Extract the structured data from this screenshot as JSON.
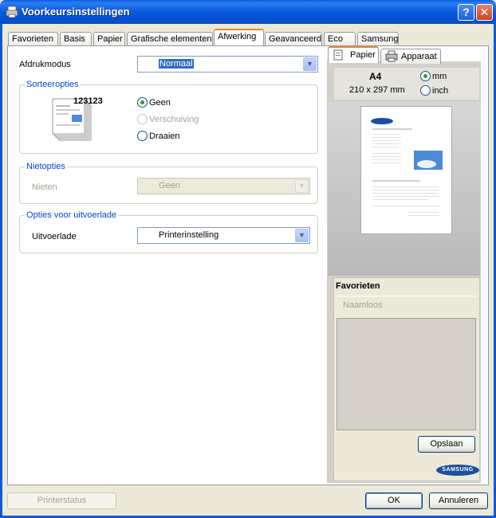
{
  "window": {
    "title": "Voorkeursinstellingen"
  },
  "tabs": [
    "Favorieten",
    "Basis",
    "Papier",
    "Grafische elementen",
    "Afwerking",
    "Geavanceerd",
    "Eco",
    "Samsung"
  ],
  "active_tab": "Afwerking",
  "print_mode": {
    "label": "Afdrukmodus",
    "value": "Normaal"
  },
  "collate": {
    "legend": "Sorteeropties",
    "preview_number": "123123",
    "options": [
      "Geen",
      "Verschuiving",
      "Draaien"
    ],
    "selected": "Geen"
  },
  "staple": {
    "legend": "Nietopties",
    "label": "Nieten",
    "value": "Geen"
  },
  "output_tray": {
    "legend": "Opties voor uitvoerlade",
    "label": "Uitvoerlade",
    "value": "Printerinstelling"
  },
  "preview_tabs": [
    "Papier",
    "Apparaat"
  ],
  "paper_size": {
    "name": "A4",
    "dimensions": "210 x 297 mm"
  },
  "units": {
    "options": [
      "mm",
      "inch"
    ],
    "selected": "mm"
  },
  "brand": "SAMSUNG",
  "favorites": {
    "title": "Favorieten",
    "name_placeholder": "Naamloos",
    "save_label": "Opslaan"
  },
  "buttons": {
    "printer_status": "Printerstatus",
    "ok": "OK",
    "cancel": "Annuleren"
  },
  "colors": {
    "title_bar": "#0b5ad9",
    "legend_text": "#0046d5",
    "active_tab_accent": "#e68b2c",
    "selection": "#316ac5",
    "brand_blue": "#1d4e9e"
  }
}
